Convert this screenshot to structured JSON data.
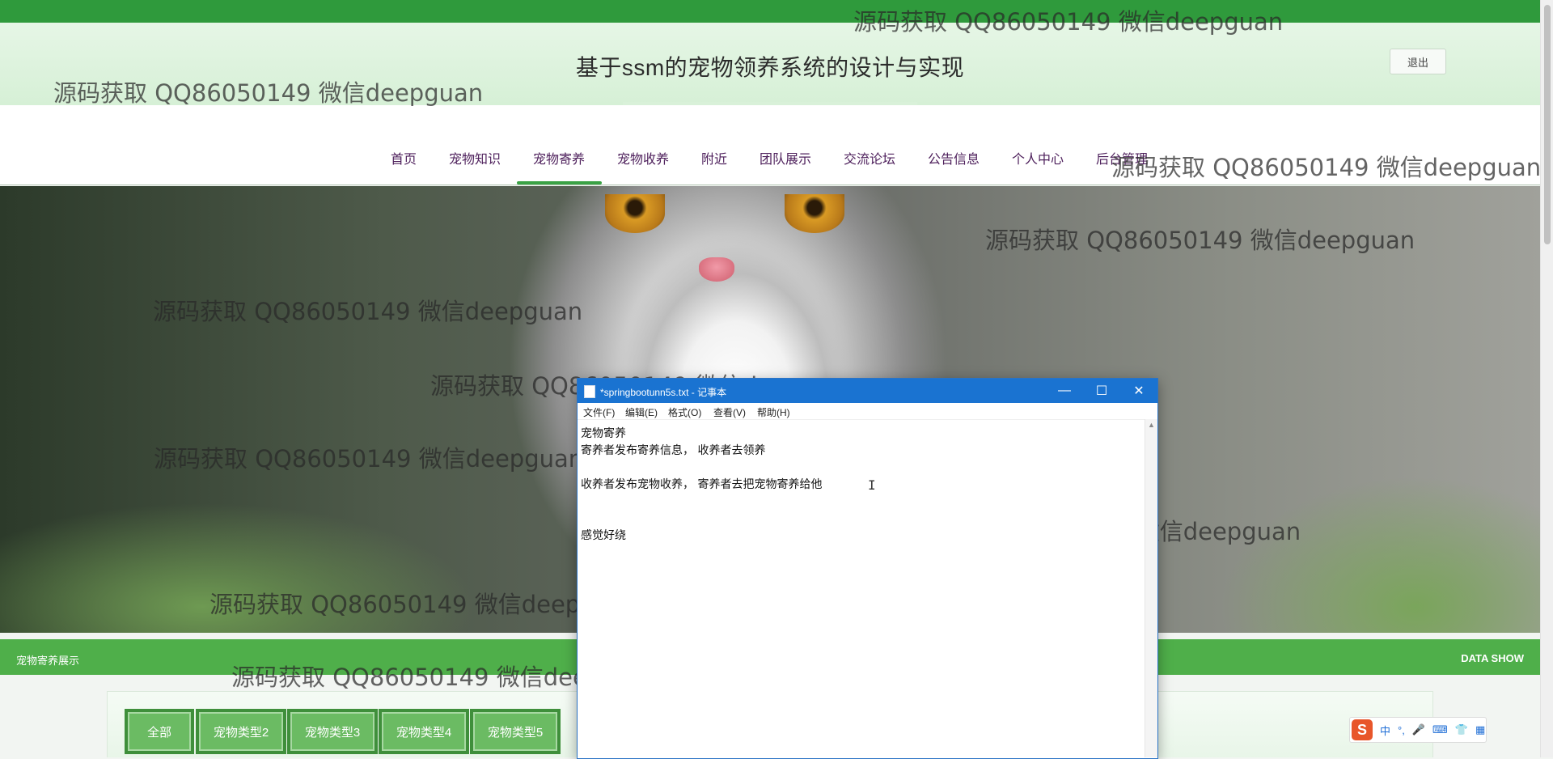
{
  "header": {
    "title": "基于ssm的宠物领养系统的设计与实现",
    "logout_label": "退出"
  },
  "nav": {
    "items": [
      "首页",
      "宠物知识",
      "宠物寄养",
      "宠物收养",
      "附近",
      "团队展示",
      "交流论坛",
      "公告信息",
      "个人中心",
      "后台管理"
    ],
    "active": "宠物寄养"
  },
  "section": {
    "title": "宠物寄养展示",
    "right_label": "DATA SHOW"
  },
  "tabs": [
    "全部",
    "宠物类型2",
    "宠物类型3",
    "宠物类型4",
    "宠物类型5"
  ],
  "notepad": {
    "window_title": "*springbootunn5s.txt - 记事本",
    "menu": [
      "文件(F)",
      "编辑(E)",
      "格式(O)",
      "查看(V)",
      "帮助(H)"
    ],
    "lines": [
      "宠物寄养",
      "寄养者发布寄养信息， 收养者去领养",
      "",
      "收养者发布宠物收养， 寄养者去把宠物寄养给他",
      "",
      "",
      "感觉好绕"
    ],
    "controls": {
      "minimize": "—",
      "maximize": "☐",
      "close": "✕"
    }
  },
  "ime": {
    "logo": "S",
    "items": [
      "中",
      "°,",
      "🎤",
      "⌨",
      "👕",
      "▦"
    ]
  },
  "watermark": "源码获取 QQ86050149 微信deepguan",
  "icons": {
    "notepad": "notepad-file-icon",
    "cursor": "text-cursor-icon"
  }
}
